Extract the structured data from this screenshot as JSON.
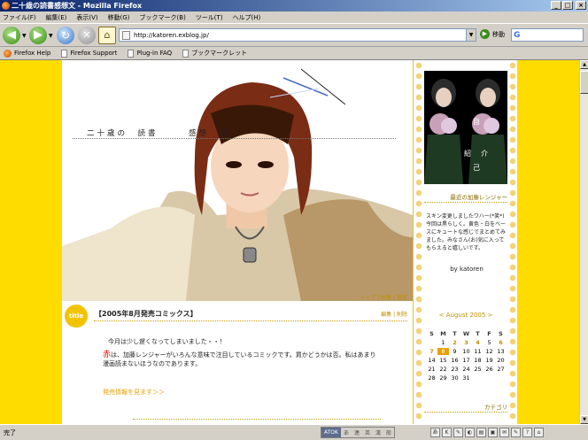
{
  "window": {
    "title": "二十歳の読書感想文 - Mozilla Firefox",
    "buttons": [
      "_",
      "□",
      "×"
    ]
  },
  "menu": [
    "ファイル(F)",
    "編集(E)",
    "表示(V)",
    "移動(G)",
    "ブックマーク(B)",
    "ツール(T)",
    "ヘルプ(H)"
  ],
  "nav": {
    "url": "http://katoren.exblog.jp/",
    "go_label": "移動",
    "search_value": ""
  },
  "bookmarks": [
    "Firefox Help",
    "Firefox Support",
    "Plug-in FAQ",
    "ブックマークレット"
  ],
  "blog": {
    "title": "二十歳の　読書　　　感想　文",
    "toplinks": "トップ | 画像 | 設定"
  },
  "sidebar": {
    "profile_chars": [
      "自",
      "己",
      "紹",
      "介"
    ],
    "heading1": "最近の加藤レンジャー",
    "text": "スキン変更しましたワハー(*笑*)今回は黒らしく。黄色・白をベースにキュートな感じでまとめてみました。みなさん(お)気に入ってもらえると嬉しいです。",
    "byline": "by katoren",
    "calendar_title": "< August 2005 >",
    "calendar_days": [
      "S",
      "M",
      "T",
      "W",
      "T",
      "F",
      "S"
    ],
    "calendar_cells": [
      "",
      "1",
      "2",
      "3",
      "4",
      "5",
      "6",
      "7",
      "8",
      "9",
      "10",
      "11",
      "12",
      "13",
      "14",
      "15",
      "16",
      "17",
      "18",
      "19",
      "20",
      "21",
      "22",
      "23",
      "24",
      "25",
      "26",
      "27",
      "28",
      "29",
      "30",
      "31"
    ],
    "calendar_linked": [
      "2",
      "3",
      "4",
      "6",
      "7"
    ],
    "calendar_today": "8",
    "heading2": "カテゴリ"
  },
  "post": {
    "badge": "title",
    "title": "【2005年8月発売コミックス】",
    "edit_links": "編集 | 削除",
    "line1": "今月は少し遅くなってしまいました・・！",
    "line2_red": "赤",
    "line2": "は、加藤レンジャーがいろんな意味で注目しているコミックです。買かどうかは否。私はあまり",
    "line3": "漫画読まないほうなのであります。",
    "more": "発売情報を見ます＞＞"
  },
  "status": {
    "text": "完了",
    "ime": "ATOK",
    "ime_keys": [
      "あ",
      "連",
      "英",
      "漢",
      "般"
    ],
    "tray": [
      "あ",
      "K",
      "✎",
      "◐",
      "▤",
      "▣",
      "✉",
      "✎",
      "?",
      "⌂"
    ]
  },
  "colors": {
    "accent": "#ffdc00",
    "link": "#c09000",
    "today": "#e8a000"
  }
}
